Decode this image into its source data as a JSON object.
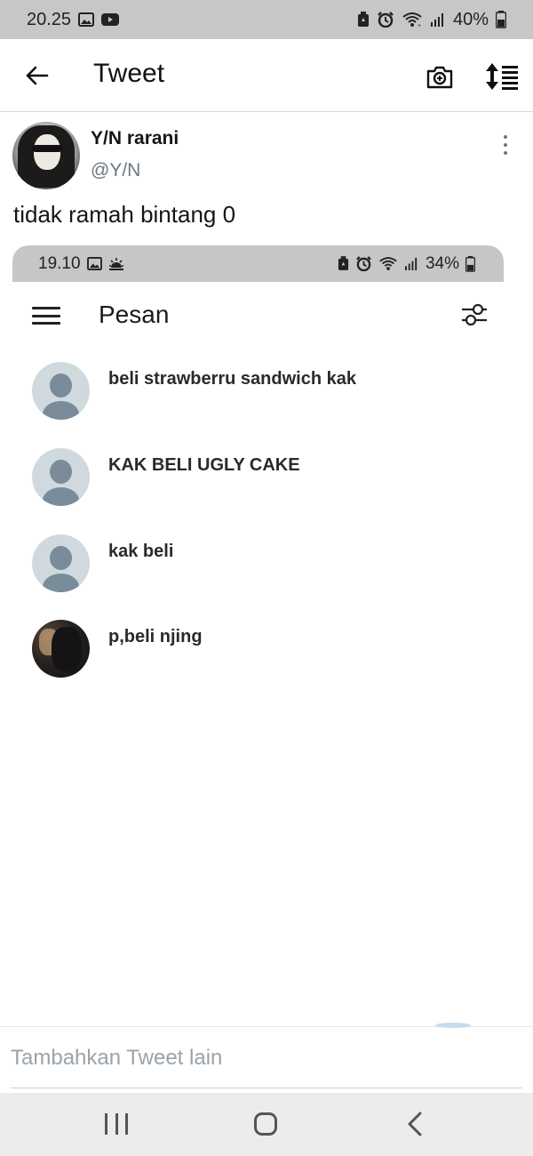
{
  "status_bar": {
    "time": "20.25",
    "battery": "40%",
    "icons": [
      "gallery-icon",
      "youtube-icon",
      "battery-saver-icon",
      "alarm-icon",
      "wifi-icon",
      "signal-icon",
      "battery-icon"
    ]
  },
  "header": {
    "title": "Tweet",
    "icons": [
      "back-arrow-icon",
      "camera-icon",
      "sort-icon"
    ]
  },
  "tweet": {
    "author_name": "Y/N rarani",
    "author_handle": "@Y/N",
    "text": "tidak ramah bintang 0"
  },
  "embedded_screenshot": {
    "status_time": "19.10",
    "status_battery": "34%",
    "title": "Pesan",
    "messages": [
      {
        "text": "beli strawberru sandwich kak",
        "avatar": "default"
      },
      {
        "text": "KAK BELI UGLY CAKE",
        "avatar": "default"
      },
      {
        "text": "kak beli",
        "avatar": "default"
      },
      {
        "text": "p,beli njing",
        "avatar": "photo"
      }
    ]
  },
  "compose": {
    "placeholder": "Tambahkan Tweet lain"
  },
  "nav_bar": {
    "icons": [
      "recent-apps-icon",
      "home-icon",
      "back-icon"
    ]
  },
  "colors": {
    "status_bar_bg": "#c7c7c7",
    "text_primary": "#14171a",
    "text_secondary": "#6b7884",
    "nav_bar_bg": "#ececec"
  }
}
